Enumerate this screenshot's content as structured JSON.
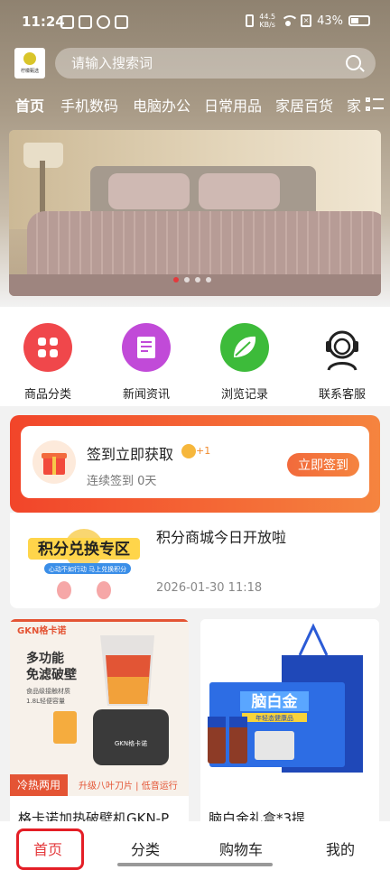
{
  "status_bar": {
    "time": "11:24",
    "net_speed_value": "44.5",
    "net_speed_unit": "KB/s",
    "battery": "43%"
  },
  "header": {
    "logo_text": "柠檬甄选",
    "search": {
      "placeholder": "请输入搜索词"
    }
  },
  "category_tabs": [
    "首页",
    "手机数码",
    "电脑办公",
    "日常用品",
    "家居百货",
    "家"
  ],
  "banner": {
    "slide_count": 4,
    "active_slide": 1
  },
  "quick_menu": [
    {
      "label": "商品分类",
      "icon": "grid-icon",
      "color": "#f0474b"
    },
    {
      "label": "新闻资讯",
      "icon": "news-icon",
      "color": "#c14ad8"
    },
    {
      "label": "浏览记录",
      "icon": "leaf-icon",
      "color": "#3dbb3a"
    },
    {
      "label": "联系客服",
      "icon": "headset-icon",
      "color": "#222222"
    }
  ],
  "signin": {
    "title": "签到立即获取",
    "bonus": "+1",
    "subtitle": "连续签到 0天",
    "button": "立即签到"
  },
  "news": {
    "image_text": "积分兑换专区",
    "image_sub": "心动不如行动 马上兑换积分",
    "title": "积分商城今日开放啦",
    "date": "2026-01-30 11:18"
  },
  "products": [
    {
      "name": "格卡诺加热破壁机GKN-P",
      "brand": "GKN格卡诺",
      "headline": "多功能\n免滤破壁",
      "spec1": "食品级接触材质",
      "spec2": "1.8L轻便容量",
      "tag": "冷热两用",
      "features": "升级八叶刀片 | 低音运行"
    },
    {
      "name": "脑白金礼盒*3提",
      "box_text": "脑白金",
      "box_sub": "年轻态健康品"
    }
  ],
  "bottom_nav": [
    "首页",
    "分类",
    "购物车",
    "我的"
  ],
  "colors": {
    "accent": "#e4393c",
    "signin_gradient_start": "#f2452a",
    "signin_gradient_end": "#f5843f"
  }
}
